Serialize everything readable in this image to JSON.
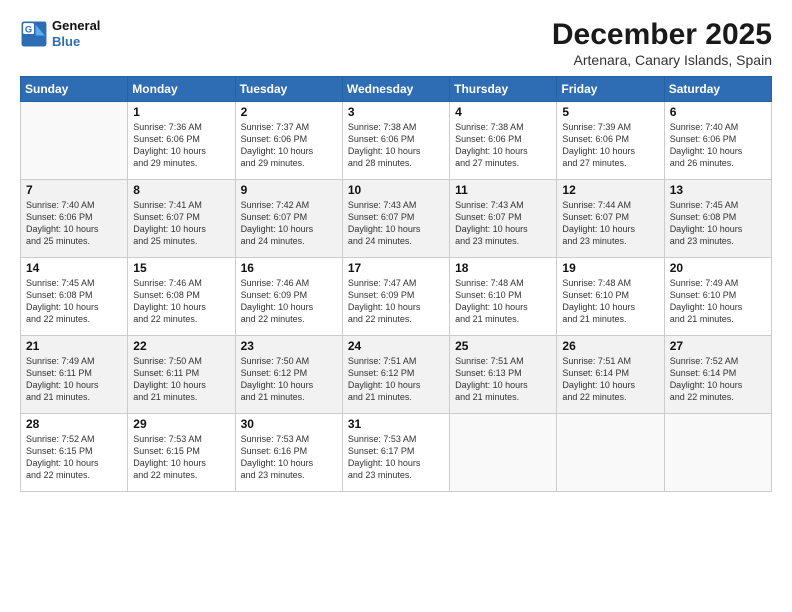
{
  "logo": {
    "line1": "General",
    "line2": "Blue"
  },
  "title": "December 2025",
  "location": "Artenara, Canary Islands, Spain",
  "weekdays": [
    "Sunday",
    "Monday",
    "Tuesday",
    "Wednesday",
    "Thursday",
    "Friday",
    "Saturday"
  ],
  "weeks": [
    [
      {
        "day": "",
        "info": ""
      },
      {
        "day": "1",
        "info": "Sunrise: 7:36 AM\nSunset: 6:06 PM\nDaylight: 10 hours\nand 29 minutes."
      },
      {
        "day": "2",
        "info": "Sunrise: 7:37 AM\nSunset: 6:06 PM\nDaylight: 10 hours\nand 29 minutes."
      },
      {
        "day": "3",
        "info": "Sunrise: 7:38 AM\nSunset: 6:06 PM\nDaylight: 10 hours\nand 28 minutes."
      },
      {
        "day": "4",
        "info": "Sunrise: 7:38 AM\nSunset: 6:06 PM\nDaylight: 10 hours\nand 27 minutes."
      },
      {
        "day": "5",
        "info": "Sunrise: 7:39 AM\nSunset: 6:06 PM\nDaylight: 10 hours\nand 27 minutes."
      },
      {
        "day": "6",
        "info": "Sunrise: 7:40 AM\nSunset: 6:06 PM\nDaylight: 10 hours\nand 26 minutes."
      }
    ],
    [
      {
        "day": "7",
        "info": "Sunrise: 7:40 AM\nSunset: 6:06 PM\nDaylight: 10 hours\nand 25 minutes."
      },
      {
        "day": "8",
        "info": "Sunrise: 7:41 AM\nSunset: 6:07 PM\nDaylight: 10 hours\nand 25 minutes."
      },
      {
        "day": "9",
        "info": "Sunrise: 7:42 AM\nSunset: 6:07 PM\nDaylight: 10 hours\nand 24 minutes."
      },
      {
        "day": "10",
        "info": "Sunrise: 7:43 AM\nSunset: 6:07 PM\nDaylight: 10 hours\nand 24 minutes."
      },
      {
        "day": "11",
        "info": "Sunrise: 7:43 AM\nSunset: 6:07 PM\nDaylight: 10 hours\nand 23 minutes."
      },
      {
        "day": "12",
        "info": "Sunrise: 7:44 AM\nSunset: 6:07 PM\nDaylight: 10 hours\nand 23 minutes."
      },
      {
        "day": "13",
        "info": "Sunrise: 7:45 AM\nSunset: 6:08 PM\nDaylight: 10 hours\nand 23 minutes."
      }
    ],
    [
      {
        "day": "14",
        "info": "Sunrise: 7:45 AM\nSunset: 6:08 PM\nDaylight: 10 hours\nand 22 minutes."
      },
      {
        "day": "15",
        "info": "Sunrise: 7:46 AM\nSunset: 6:08 PM\nDaylight: 10 hours\nand 22 minutes."
      },
      {
        "day": "16",
        "info": "Sunrise: 7:46 AM\nSunset: 6:09 PM\nDaylight: 10 hours\nand 22 minutes."
      },
      {
        "day": "17",
        "info": "Sunrise: 7:47 AM\nSunset: 6:09 PM\nDaylight: 10 hours\nand 22 minutes."
      },
      {
        "day": "18",
        "info": "Sunrise: 7:48 AM\nSunset: 6:10 PM\nDaylight: 10 hours\nand 21 minutes."
      },
      {
        "day": "19",
        "info": "Sunrise: 7:48 AM\nSunset: 6:10 PM\nDaylight: 10 hours\nand 21 minutes."
      },
      {
        "day": "20",
        "info": "Sunrise: 7:49 AM\nSunset: 6:10 PM\nDaylight: 10 hours\nand 21 minutes."
      }
    ],
    [
      {
        "day": "21",
        "info": "Sunrise: 7:49 AM\nSunset: 6:11 PM\nDaylight: 10 hours\nand 21 minutes."
      },
      {
        "day": "22",
        "info": "Sunrise: 7:50 AM\nSunset: 6:11 PM\nDaylight: 10 hours\nand 21 minutes."
      },
      {
        "day": "23",
        "info": "Sunrise: 7:50 AM\nSunset: 6:12 PM\nDaylight: 10 hours\nand 21 minutes."
      },
      {
        "day": "24",
        "info": "Sunrise: 7:51 AM\nSunset: 6:12 PM\nDaylight: 10 hours\nand 21 minutes."
      },
      {
        "day": "25",
        "info": "Sunrise: 7:51 AM\nSunset: 6:13 PM\nDaylight: 10 hours\nand 21 minutes."
      },
      {
        "day": "26",
        "info": "Sunrise: 7:51 AM\nSunset: 6:14 PM\nDaylight: 10 hours\nand 22 minutes."
      },
      {
        "day": "27",
        "info": "Sunrise: 7:52 AM\nSunset: 6:14 PM\nDaylight: 10 hours\nand 22 minutes."
      }
    ],
    [
      {
        "day": "28",
        "info": "Sunrise: 7:52 AM\nSunset: 6:15 PM\nDaylight: 10 hours\nand 22 minutes."
      },
      {
        "day": "29",
        "info": "Sunrise: 7:53 AM\nSunset: 6:15 PM\nDaylight: 10 hours\nand 22 minutes."
      },
      {
        "day": "30",
        "info": "Sunrise: 7:53 AM\nSunset: 6:16 PM\nDaylight: 10 hours\nand 23 minutes."
      },
      {
        "day": "31",
        "info": "Sunrise: 7:53 AM\nSunset: 6:17 PM\nDaylight: 10 hours\nand 23 minutes."
      },
      {
        "day": "",
        "info": ""
      },
      {
        "day": "",
        "info": ""
      },
      {
        "day": "",
        "info": ""
      }
    ]
  ]
}
